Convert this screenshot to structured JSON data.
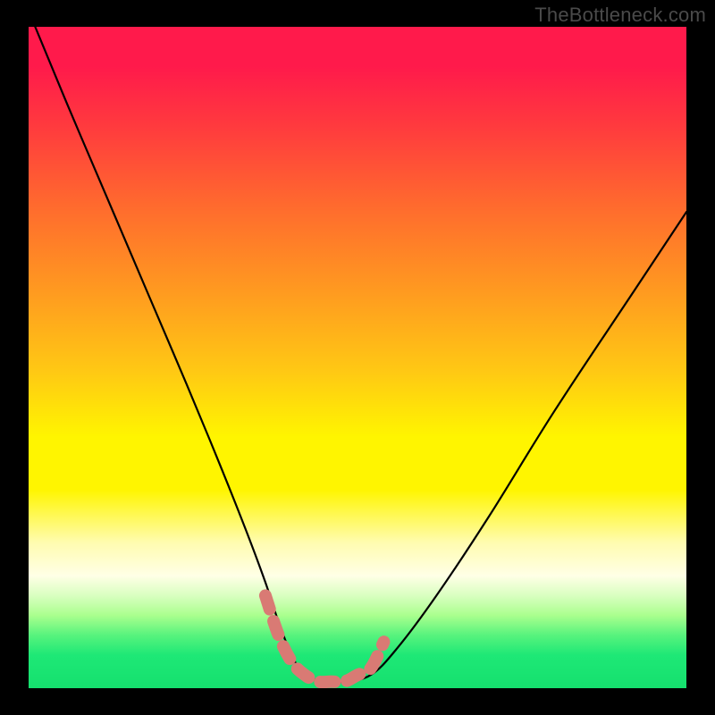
{
  "watermark": "TheBottleneck.com",
  "chart_data": {
    "type": "line",
    "title": "",
    "xlabel": "",
    "ylabel": "",
    "xlim": [
      0,
      100
    ],
    "ylim": [
      0,
      100
    ],
    "grid": false,
    "legend": false,
    "series": [
      {
        "name": "bottleneck-curve",
        "color": "#000000",
        "x": [
          1,
          6,
          12,
          18,
          24,
          29,
          33,
          36,
          38,
          40,
          42,
          45,
          48,
          52,
          56,
          62,
          70,
          80,
          92,
          100
        ],
        "y": [
          100,
          88,
          74,
          60,
          46,
          34,
          24,
          16,
          10,
          5,
          2,
          1,
          1,
          2,
          6,
          14,
          26,
          42,
          60,
          72
        ]
      },
      {
        "name": "trough-highlight",
        "color": "#d97a74",
        "x": [
          36,
          38,
          40,
          42,
          44,
          46,
          48,
          50,
          52,
          54
        ],
        "y": [
          14,
          8,
          4,
          2,
          1,
          1,
          1,
          2,
          3,
          7
        ]
      }
    ],
    "background_gradient": {
      "top": "#ff1a4b",
      "mid": "#fff500",
      "bottom": "#15e06e"
    }
  }
}
